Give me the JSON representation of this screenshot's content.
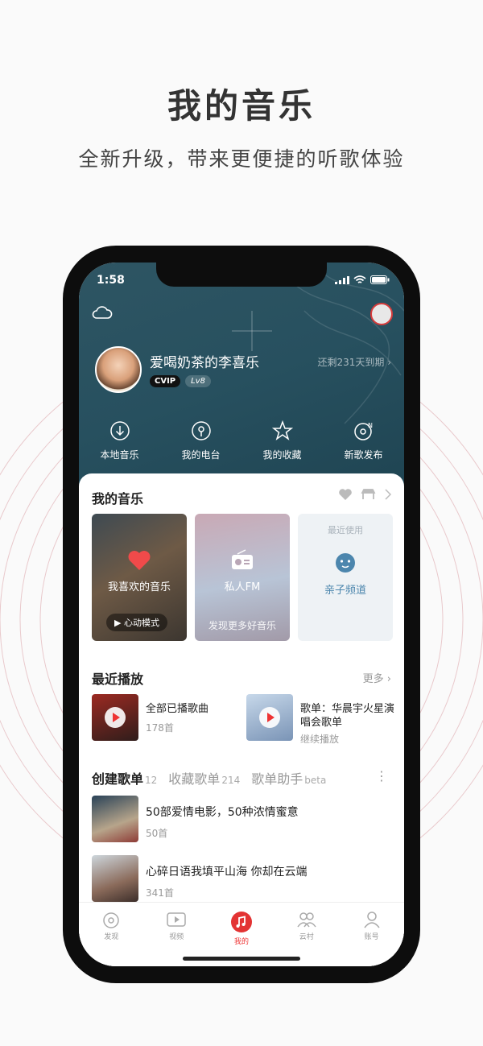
{
  "promo": {
    "title": "我的音乐",
    "subtitle": "全新升级，带来更便捷的听歌体验"
  },
  "status_bar": {
    "time": "1:58"
  },
  "profile": {
    "username": "爱喝奶茶的李喜乐",
    "vip_badge": "CVIP",
    "level_badge": "Lv8",
    "expire_text": "还剩231天到期 ›"
  },
  "quick_actions": [
    {
      "label": "本地音乐",
      "icon": "download-circle-icon"
    },
    {
      "label": "我的电台",
      "icon": "radio-podcast-icon"
    },
    {
      "label": "我的收藏",
      "icon": "star-icon"
    },
    {
      "label": "新歌发布",
      "icon": "new-album-icon"
    }
  ],
  "my_music": {
    "title": "我的音乐",
    "cards": [
      {
        "label": "我喜欢的音乐",
        "button": "▶ 心动模式"
      },
      {
        "label": "私人FM",
        "footer": "发现更多好音乐"
      },
      {
        "top_label": "最近使用",
        "label": "亲子频道"
      }
    ]
  },
  "recent": {
    "title": "最近播放",
    "more": "更多 ›",
    "items": [
      {
        "title": "全部已播歌曲",
        "sub": "178首"
      },
      {
        "title": "歌单：华晨宇火星演唱会歌单",
        "sub": "继续播放"
      }
    ]
  },
  "playlist_tabs": [
    {
      "label": "创建歌单",
      "count": "12"
    },
    {
      "label": "收藏歌单",
      "count": "214"
    },
    {
      "label": "歌单助手",
      "count": "beta"
    }
  ],
  "playlists": [
    {
      "title": "50部爱情电影，50种浓情蜜意",
      "sub": "50首"
    },
    {
      "title": "心碎日语我填平山海 你却在云端",
      "sub": "341首"
    }
  ],
  "tabbar": [
    {
      "label": "发现",
      "icon": "discover-icon"
    },
    {
      "label": "视频",
      "icon": "video-icon"
    },
    {
      "label": "我的",
      "icon": "music-note-icon"
    },
    {
      "label": "云村",
      "icon": "community-icon"
    },
    {
      "label": "账号",
      "icon": "account-icon"
    }
  ],
  "colors": {
    "accent": "#e33333",
    "hero_bg": "#27505f",
    "kid_channel": "#4c86ad"
  }
}
